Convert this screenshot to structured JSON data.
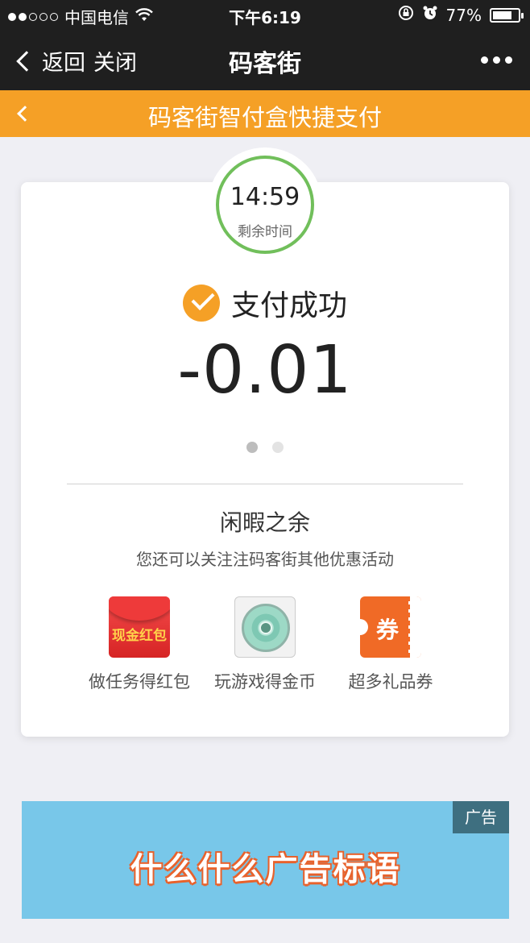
{
  "status_bar": {
    "carrier": "中国电信",
    "time": "下午6:19",
    "battery": "77%",
    "battery_level": 0.77,
    "signal_bars_filled": 2,
    "signal_bars_total": 5
  },
  "nav": {
    "back_label": "返回",
    "close_label": "关闭",
    "title": "码客街"
  },
  "header": {
    "title": "码客街智付盒快捷支付"
  },
  "payment": {
    "countdown": "14:59",
    "countdown_label": "剩余时间",
    "status": "支付成功",
    "amount": "-0.01"
  },
  "carousel": {
    "pages": 2,
    "active": 0
  },
  "leisure": {
    "title": "闲暇之余",
    "subtitle": "您还可以关注注码客街其他优惠活动"
  },
  "activities": [
    {
      "label": "做任务得红包",
      "icon": "red-packet-icon",
      "icon_text": "现金红包"
    },
    {
      "label": "玩游戏得金币",
      "icon": "game-disc-icon"
    },
    {
      "label": "超多礼品券",
      "icon": "coupon-icon",
      "icon_text": "券"
    }
  ],
  "ad": {
    "tag": "广告",
    "slogan": "什么什么广告标语"
  },
  "colors": {
    "accent_orange": "#f5a026",
    "timer_green": "#71bf5b",
    "ad_blue": "#78c7e9"
  }
}
